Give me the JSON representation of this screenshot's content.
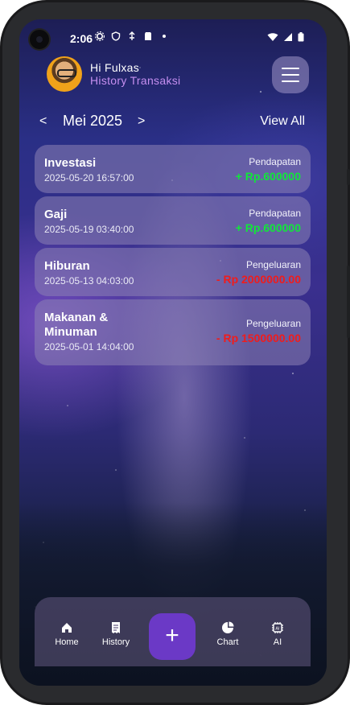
{
  "status_bar": {
    "time": "2:06"
  },
  "header": {
    "greeting": "Hi Fulxas",
    "subtitle": "History Transaksi"
  },
  "month_nav": {
    "prev": "<",
    "month": "Mei 2025",
    "next": ">",
    "view_all": "View All"
  },
  "transactions": [
    {
      "title": "Investasi",
      "date": "2025-05-20 16:57:00",
      "type": "Pendapatan",
      "amount": "+ Rp.600000"
    },
    {
      "title": "Gaji",
      "date": "2025-05-19 03:40:00",
      "type": "Pendapatan",
      "amount": "+ Rp.600000"
    },
    {
      "title": "Hiburan",
      "date": "2025-05-13 04:03:00",
      "type": "Pengeluaran",
      "amount": "- Rp 2000000.00"
    },
    {
      "title": "Makanan & Minuman",
      "date": "2025-05-01 14:04:00",
      "type": "Pengeluaran",
      "amount": "- Rp 1500000.00"
    }
  ],
  "bottom_nav": {
    "home": "Home",
    "history": "History",
    "fab": "+",
    "chart": "Chart",
    "ai": "AI"
  },
  "colors": {
    "income": "#12e63a",
    "expense": "#f01c1c",
    "accent": "#6b39c6",
    "subtitle": "#c58ff0"
  }
}
